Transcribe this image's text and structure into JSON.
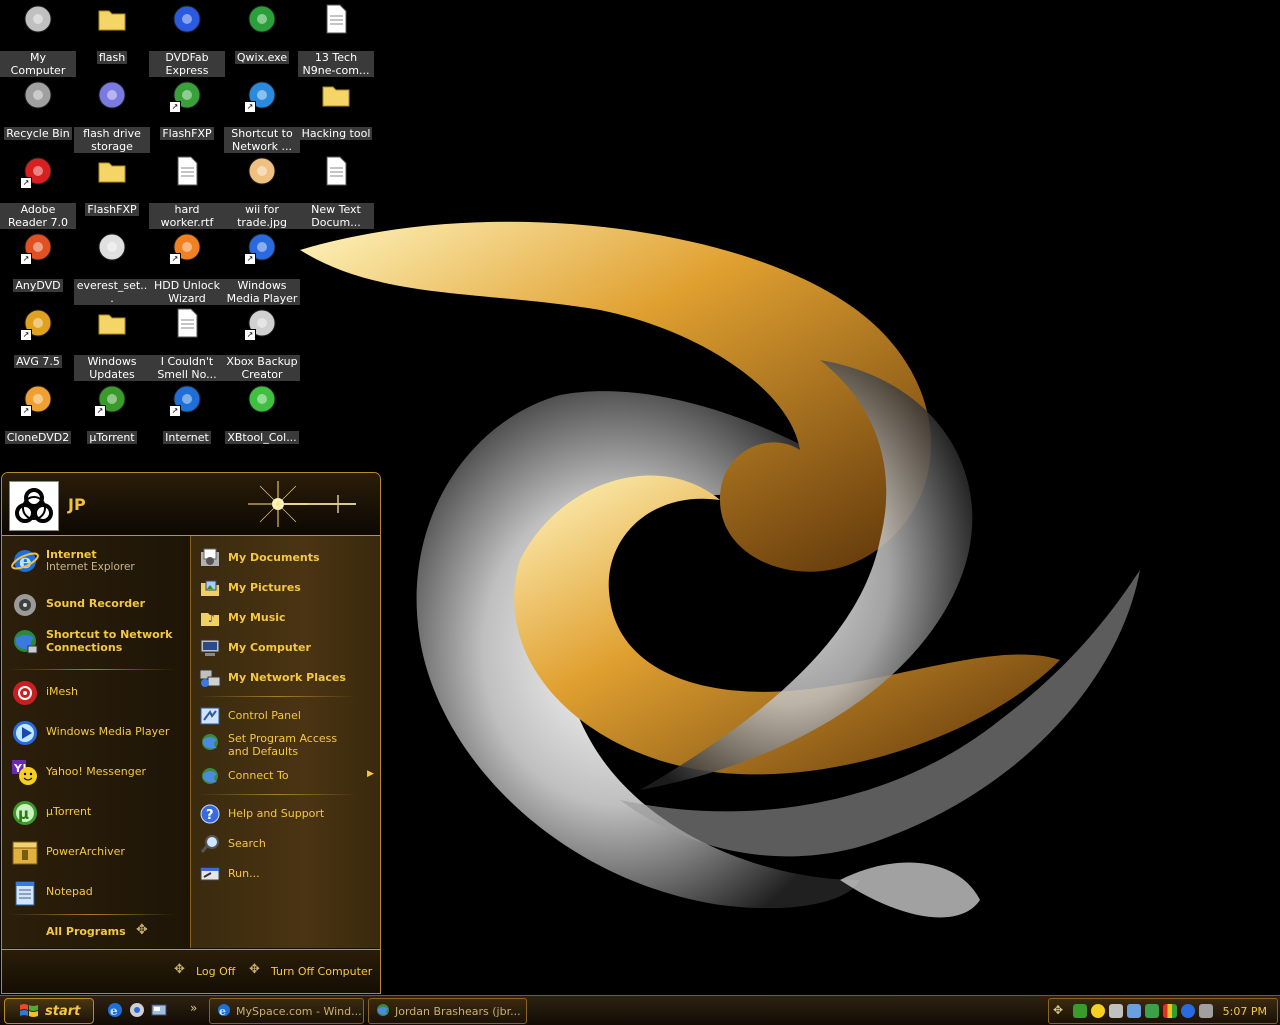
{
  "desktop": {
    "icons": [
      {
        "label": "My Computer",
        "icon": "my-computer-icon"
      },
      {
        "label": "flash",
        "icon": "folder-icon"
      },
      {
        "label": "DVDFab Express",
        "icon": "dvdfab-icon"
      },
      {
        "label": "Qwix.exe",
        "icon": "qwix-icon"
      },
      {
        "label": "13 Tech N9ne-com...",
        "icon": "mp3-file-icon"
      },
      {
        "label": "Recycle Bin",
        "icon": "recycle-bin-icon"
      },
      {
        "label": "flash drive storage",
        "icon": "flash-drive-icon"
      },
      {
        "label": "FlashFXP",
        "icon": "flashfxp-icon"
      },
      {
        "label": "Shortcut to Network ...",
        "icon": "network-connections-icon"
      },
      {
        "label": "Hacking tool",
        "icon": "folder-icon"
      },
      {
        "label": "Adobe Reader 7.0",
        "icon": "adobe-reader-icon"
      },
      {
        "label": "FlashFXP",
        "icon": "folder-icon"
      },
      {
        "label": "hard worker.rtf",
        "icon": "rtf-file-icon"
      },
      {
        "label": "wii for trade.jpg",
        "icon": "jpg-file-icon"
      },
      {
        "label": "New Text Docum...",
        "icon": "text-file-icon"
      },
      {
        "label": "AnyDVD",
        "icon": "anydvd-icon"
      },
      {
        "label": "everest_set...",
        "icon": "everest-setup-icon"
      },
      {
        "label": "HDD Unlock Wizard",
        "icon": "hdd-unlock-icon"
      },
      {
        "label": "Windows Media Player",
        "icon": "media-player-icon"
      },
      {
        "label": "AVG 7.5",
        "icon": "avg-icon"
      },
      {
        "label": "Windows Updates",
        "icon": "folder-icon"
      },
      {
        "label": "I Couldn't Smell No...",
        "icon": "mp3-file-icon"
      },
      {
        "label": "Xbox Backup Creator",
        "icon": "xbox-backup-icon"
      },
      {
        "label": "CloneDVD2",
        "icon": "clonedvd-icon"
      },
      {
        "label": "µTorrent",
        "icon": "utorrent-icon"
      },
      {
        "label": "Internet",
        "icon": "internet-explorer-icon"
      },
      {
        "label": "XBtool_Col...",
        "icon": "xbtool-icon"
      }
    ]
  },
  "start_menu": {
    "user": "JP",
    "pinned": [
      {
        "title": "Internet",
        "subtitle": "Internet Explorer",
        "icon": "internet-explorer-icon"
      },
      {
        "title": "Sound Recorder",
        "icon": "sound-recorder-icon"
      },
      {
        "title": "Shortcut to Network Connections",
        "icon": "network-connections-icon"
      }
    ],
    "recent": [
      {
        "label": "iMesh",
        "icon": "imesh-icon"
      },
      {
        "label": "Windows Media Player",
        "icon": "media-player-icon"
      },
      {
        "label": "Yahoo! Messenger",
        "icon": "yahoo-messenger-icon"
      },
      {
        "label": "µTorrent",
        "icon": "utorrent-icon"
      },
      {
        "label": "PowerArchiver",
        "icon": "powerarchiver-icon"
      },
      {
        "label": "Notepad",
        "icon": "notepad-icon"
      }
    ],
    "all_programs": "All Programs",
    "places": [
      {
        "label": "My Documents",
        "icon": "my-documents-icon"
      },
      {
        "label": "My Pictures",
        "icon": "my-pictures-icon"
      },
      {
        "label": "My Music",
        "icon": "my-music-icon"
      },
      {
        "label": "My Computer",
        "icon": "my-computer-icon"
      },
      {
        "label": "My Network Places",
        "icon": "network-places-icon"
      }
    ],
    "settings": [
      {
        "label": "Control Panel",
        "icon": "control-panel-icon"
      },
      {
        "label": "Set Program Access and Defaults",
        "icon": "program-access-icon"
      },
      {
        "label": "Connect To",
        "icon": "connect-to-icon"
      }
    ],
    "help": [
      {
        "label": "Help and Support",
        "icon": "help-icon"
      },
      {
        "label": "Search",
        "icon": "search-icon"
      },
      {
        "label": "Run...",
        "icon": "run-icon"
      }
    ],
    "log_off": "Log Off",
    "turn_off": "Turn Off Computer"
  },
  "taskbar": {
    "start_label": "start",
    "tasks": [
      {
        "label": "MySpace.com - Wind...",
        "icon": "internet-explorer-icon"
      },
      {
        "label": "Jordan Brashears (jbr...",
        "icon": "messenger-window-icon"
      }
    ],
    "clock": "5:07 PM"
  }
}
